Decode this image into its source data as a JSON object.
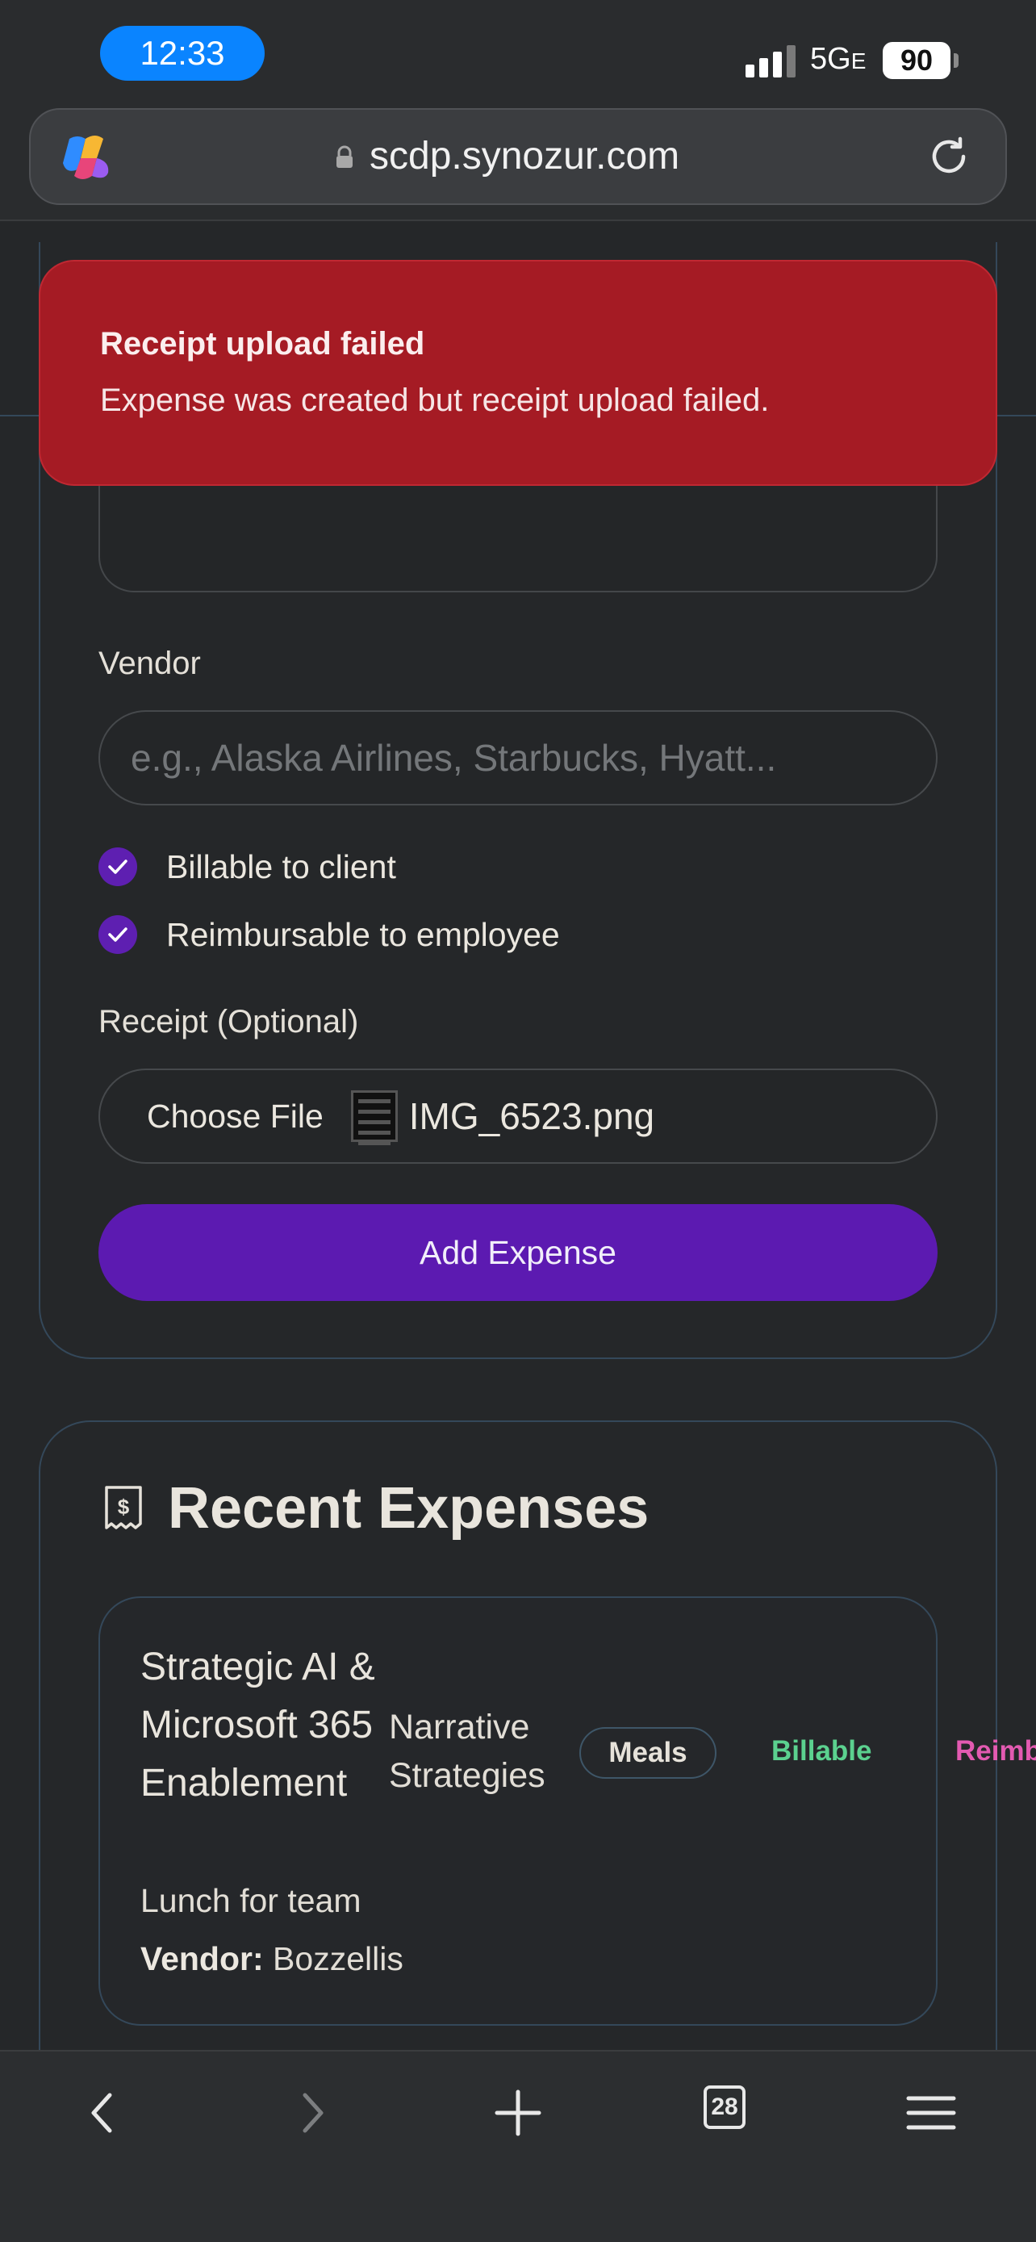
{
  "status_bar": {
    "time": "12:33",
    "network": "5G",
    "network_suffix": "E",
    "battery": "90"
  },
  "browser": {
    "url": "scdp.synozur.com"
  },
  "toast": {
    "title": "Receipt upload failed",
    "message": "Expense was created but receipt upload failed.",
    "color": "#a51b24"
  },
  "form": {
    "vendor_label": "Vendor",
    "vendor_placeholder": "e.g., Alaska Airlines, Starbucks, Hyatt...",
    "billable_label": "Billable to client",
    "billable_checked": true,
    "reimbursable_label": "Reimbursable to employee",
    "reimbursable_checked": true,
    "receipt_label": "Receipt (Optional)",
    "choose_file_label": "Choose File",
    "file_name": "IMG_6523.png",
    "submit_label": "Add Expense",
    "accent_color": "#5c1ab1"
  },
  "recent": {
    "title": "Recent Expenses",
    "icon": "receipt-icon",
    "items": [
      {
        "project": "Strategic AI & Microsoft 365 Enablement",
        "client": "Narrative Strategies",
        "category": "Meals",
        "billable_badge": "Billable",
        "reimbursable_badge": "Reimbursable",
        "description": "Lunch for team",
        "vendor_label": "Vendor:",
        "vendor": "Bozzellis"
      }
    ]
  },
  "toolbar": {
    "tab_count": "28",
    "icons": [
      "back-icon",
      "forward-icon",
      "new-tab-icon",
      "tabs-icon",
      "menu-icon"
    ]
  }
}
